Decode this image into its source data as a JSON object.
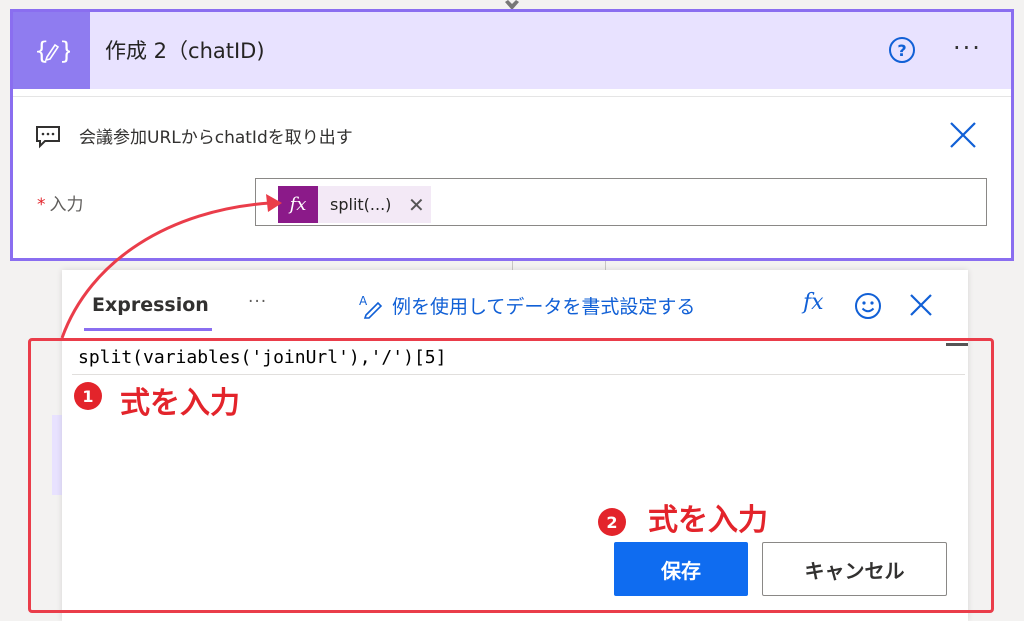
{
  "card": {
    "title": "作成 2（chatID)",
    "comment": "会議参加URLからchatIdを取り出す",
    "input_required_mark": "*",
    "input_label": "入力",
    "token_label": "split(...)",
    "token_icon": "fx-icon",
    "accent_color": "#8a6ef0"
  },
  "panel": {
    "tab_label": "Expression",
    "tab_more": "···",
    "format_link": "例を使用してデータを書式設定する",
    "fx_label": "fx",
    "expression": "split(variables('joinUrl'),'/')[5]",
    "save_label": "保存",
    "cancel_label": "キャンセル",
    "save_color": "#0f6cf0"
  },
  "annotations": {
    "step1_number": "1",
    "step1_text": "式を入力",
    "step2_number": "2",
    "step2_text": "式を入力",
    "color": "#e3242b"
  }
}
